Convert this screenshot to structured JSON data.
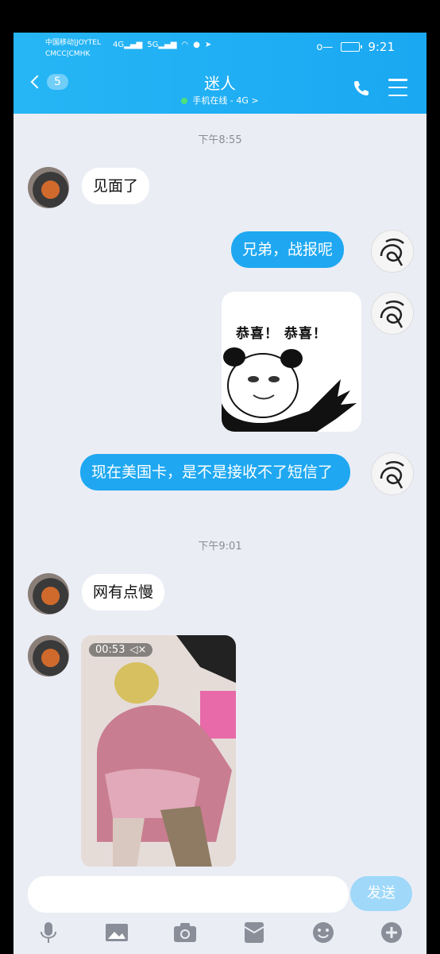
{
  "status_bar": {
    "carrier_line1": "中国移动|JOYTEL",
    "carrier_line2": "CMCC|CMHK",
    "net1": "4G",
    "net2": "5G",
    "time": "9:21"
  },
  "header": {
    "back_count": "5",
    "title": "迷人",
    "subtitle": "手机在线 - 4G >"
  },
  "messages": [
    {
      "type": "time",
      "text": "下午8:55"
    },
    {
      "type": "text",
      "side": "left",
      "text": "见面了"
    },
    {
      "type": "text",
      "side": "right",
      "text": "兄弟，战报呢"
    },
    {
      "type": "sticker",
      "side": "right",
      "text": "恭喜！ 恭喜！"
    },
    {
      "type": "text",
      "side": "right",
      "text": "现在美国卡，是不是接收不了短信了"
    },
    {
      "type": "time",
      "text": "下午9:01"
    },
    {
      "type": "text",
      "side": "left",
      "text": "网有点慢"
    },
    {
      "type": "video",
      "side": "left",
      "duration": "00:53"
    }
  ],
  "composer": {
    "input_value": "",
    "send_label": "发送"
  },
  "toolbar": [
    "mic-icon",
    "image-icon",
    "camera-icon",
    "red-packet-icon",
    "emoji-icon",
    "plus-icon"
  ],
  "colors": {
    "header_blue": "#1fa8f1",
    "bubble_out": "#1fa8f1",
    "bubble_in": "#ffffff",
    "background": "#ebedf5",
    "send_disabled": "#9fd8f9"
  }
}
